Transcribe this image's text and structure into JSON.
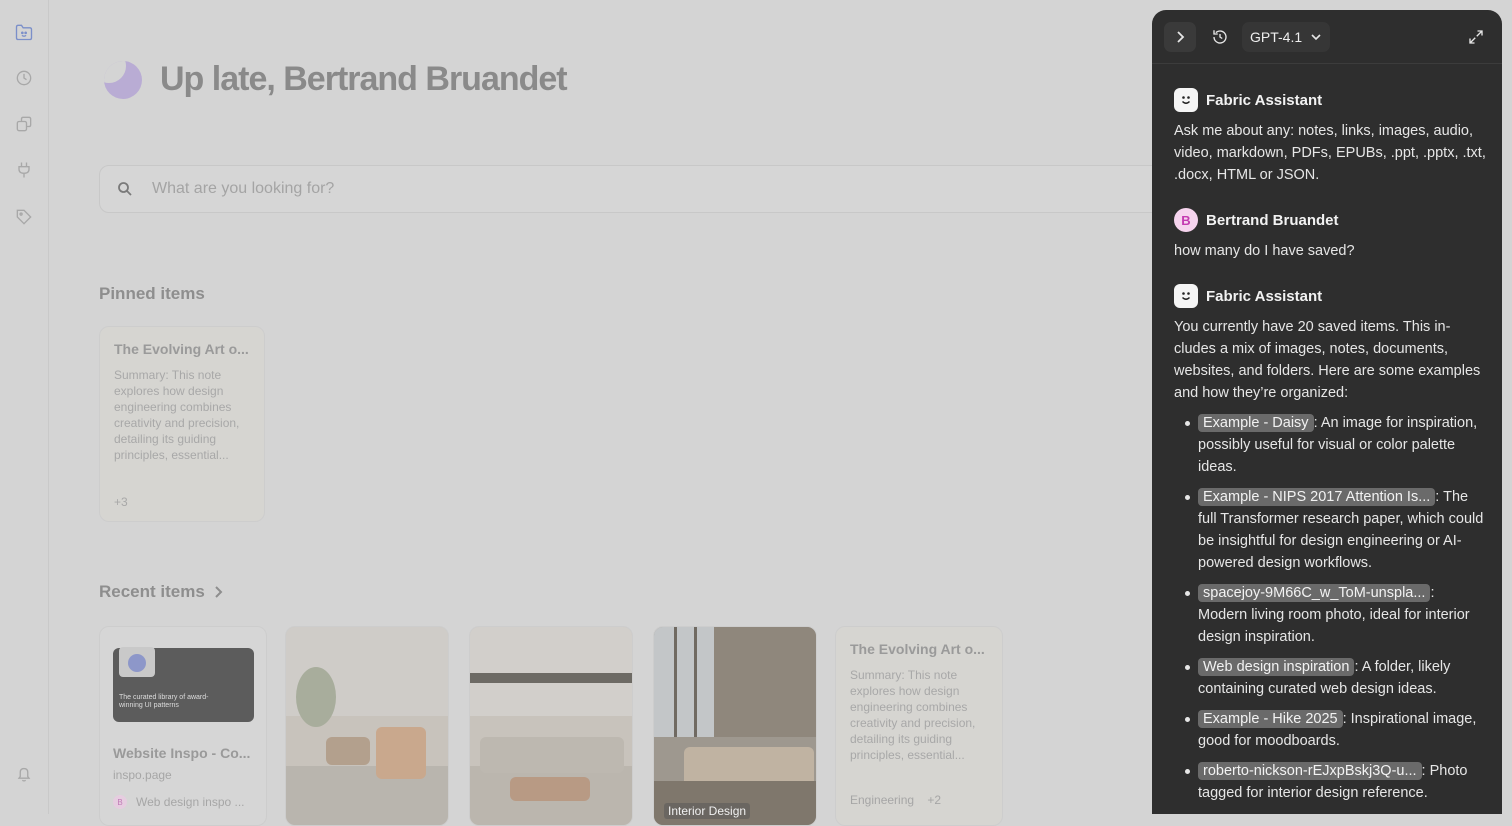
{
  "greeting": "Up late, Bertrand Bruandet",
  "search": {
    "placeholder": "What are you looking for?"
  },
  "pinned": {
    "title": "Pinned items",
    "card": {
      "title": "The Evolving Art o...",
      "summary": "Summary: This note explores how design engineering combines creativity and precision, detailing its guiding principles, essential...",
      "extra": "+3"
    }
  },
  "recent": {
    "title": "Recent items",
    "website_card": {
      "title": "Website Inspo - Co...",
      "domain": "inspo.page",
      "collection": "Web design inspo ...",
      "thumb_text": "The curated library of award-winning UI patterns"
    },
    "photo_tag": "Interior Design",
    "note_card": {
      "title": "The Evolving Art o...",
      "summary": "Summary: This note explores how design engineering combines creativity and precision, detailing its guiding principles, essential...",
      "tag": "Engineering",
      "extra": "+2"
    }
  },
  "chat": {
    "model": "GPT-4.1",
    "messages": [
      {
        "author": "Fabric Assistant",
        "text": "Ask me about any: notes, links, images, audio, video, markdown, PDFs, EPUBs, .ppt, .pptx, .txt, .docx, HTML or JSON."
      },
      {
        "author": "Bertrand Bruandet",
        "avatar_letter": "B",
        "text": "how many do I have saved?"
      },
      {
        "author": "Fabric Assistant",
        "text": "You currently have 20 saved items. This in­cludes a mix of images, notes, documents, websites, and folders. Here are some exam­ples and how they’re organized:",
        "items": [
          {
            "chip": "Example - Daisy",
            "desc": ": An image for inspira­tion, possibly useful for visual or color pal­ette ideas."
          },
          {
            "chip": "Example - NIPS 2017 Attention Is...",
            "desc": ": The full Transformer research paper, which could be insightful for design engineering or AI-powered design workflows."
          },
          {
            "chip": "spacejoy-9M66C_w_ToM-unspla...",
            "desc": ": Modern living room photo, ideal for interior design inspiration."
          },
          {
            "chip": "Web design inspiration",
            "desc": ": A folder, likely containing curated web design ideas."
          },
          {
            "chip": "Example - Hike 2025",
            "desc": ": Inspirational im­age, good for moodboards."
          },
          {
            "chip": "roberto-nickson-rEJxpBskj3Q-u...",
            "desc": ": Photo tagged for interior design reference."
          }
        ]
      }
    ]
  }
}
